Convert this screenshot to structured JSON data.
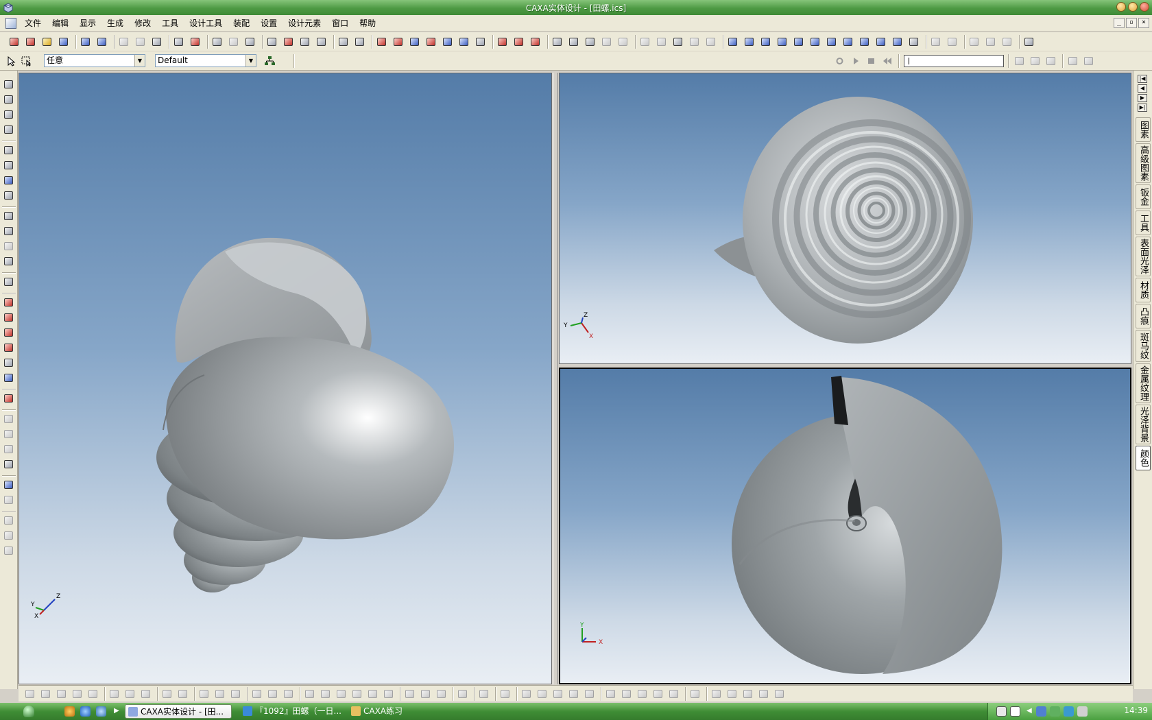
{
  "window": {
    "title": "CAXA实体设计 - [田螺.ics]"
  },
  "menu": [
    "文件",
    "编辑",
    "显示",
    "生成",
    "修改",
    "工具",
    "设计工具",
    "装配",
    "设置",
    "设计元素",
    "窗口",
    "帮助"
  ],
  "toolbar2": {
    "select_filter": "任意",
    "style_select": "Default"
  },
  "right_tabs": [
    "图素",
    "高级图素",
    "钣金",
    "工具",
    "表面光泽",
    "材质",
    "凸痕",
    "斑马纹",
    "金属纹理",
    "光泽背景",
    "颜色"
  ],
  "right_tabs_active": "颜色",
  "viewports": {
    "main": {
      "axis": {
        "x": "X",
        "y": "Y",
        "z": "Z"
      }
    },
    "top": {
      "axis": {
        "x": "X",
        "y": "Y",
        "z": "Z"
      }
    },
    "bottom": {
      "axis": {
        "x": "X",
        "y": "Y"
      }
    }
  },
  "taskbar": {
    "tasks": [
      {
        "label": "CAXA实体设计 - [田...",
        "active": true
      },
      {
        "label": "『1092』田螺（一日...",
        "active": false
      },
      {
        "label": "CAXA练习",
        "active": false
      }
    ],
    "clock": "14:39"
  },
  "colors": {
    "title_bar": "#4e9a44",
    "viewport_top": "#547ca8",
    "viewport_bottom": "#e9eef4",
    "shell": "#9da3a6"
  }
}
